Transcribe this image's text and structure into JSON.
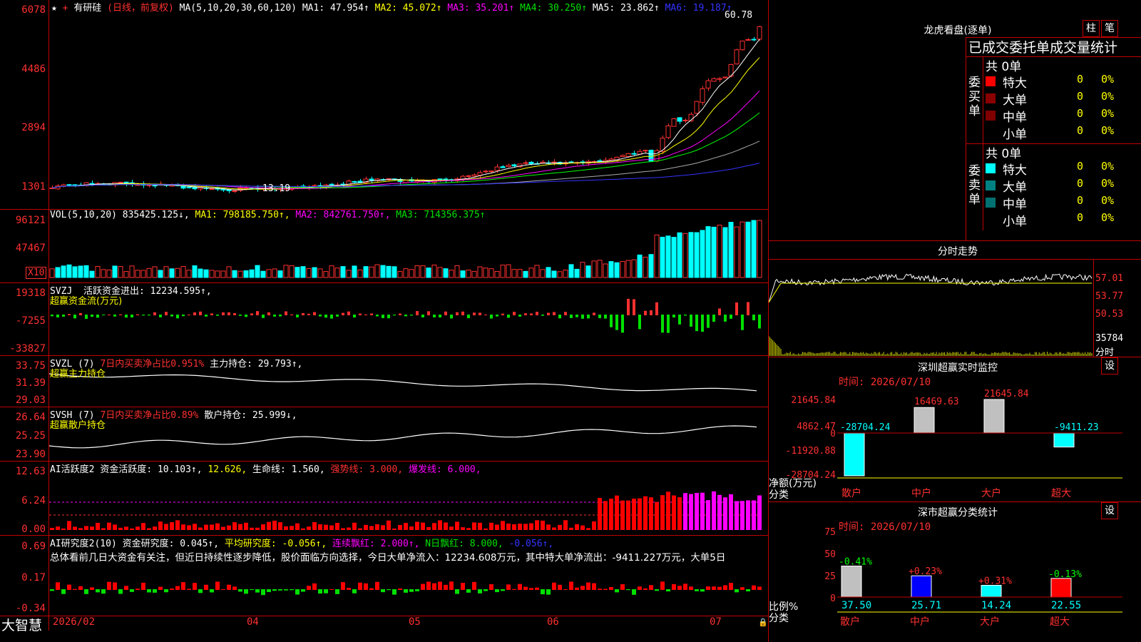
{
  "price": {
    "symbol": "有研硅",
    "period": "(日线，前复权)",
    "ma_params": "MA(5,10,20,30,60,120)",
    "ma1": "MA1: 47.954↑",
    "ma2": "MA2: 45.072↑",
    "ma3": "MA3: 35.201↑",
    "ma4": "MA4: 30.250↑",
    "ma5": "MA5: 23.862↑",
    "ma6": "MA6: 19.187↑",
    "high_marker": "60.78",
    "low_marker": "13.19",
    "ticks": [
      "6078",
      "4486",
      "2894",
      "1301"
    ]
  },
  "vol": {
    "title": "VOL(5,10,20)",
    "value": "835425.125↓,",
    "ma1": "MA1: 798185.750↑,",
    "ma2": "MA2: 842761.750↑,",
    "ma3": "MA3: 714356.375↑",
    "ticks": [
      "96121",
      "47467"
    ],
    "multiplier": "X10"
  },
  "svzj": {
    "title": "SVZJ",
    "desc": "活跃资金进出: 12234.595↑,",
    "sub": "超赢资金流(万元)",
    "ticks": [
      "19318",
      "-7255",
      "-33827"
    ]
  },
  "svzl": {
    "title": "SVZL  (7)",
    "ratio": "7日内买卖净占比0.951%",
    "main": "主力持仓: 29.793↑,",
    "sub": "超赢主力持仓",
    "ticks": [
      "33.75",
      "31.39",
      "29.03"
    ]
  },
  "svsh": {
    "title": "SVSH  (7)",
    "ratio": "7日内买卖净占比0.89%",
    "retail": "散户持仓: 25.999↓,",
    "sub": "超赢散户持仓",
    "ticks": [
      "26.64",
      "25.25",
      "23.90"
    ]
  },
  "ai1": {
    "title": "AI活跃度2",
    "a": "资金活跃度: 10.103↑,",
    "b": "12.626,",
    "c": "生命线: 1.560,",
    "d": "强势线: 3.000,",
    "e": "爆发线: 6.000,",
    "ticks": [
      "12.63",
      "6.24",
      "0.00"
    ]
  },
  "ai2": {
    "title": "AI研究度2(10)",
    "a": "资金研究度: 0.045↑,",
    "b": "平均研究度: -0.056↑,",
    "c": "连续飘红: 2.000↑,",
    "d": "N日飘红: 8.000,",
    "e": "-0.056↑,",
    "summary": "总体看前几日大资金有关注，但近日持续性逐步降低，股价面临方向选择，今日大单净流入：12234.608万元，其中特大单净流出：-9411.227万元，大单5日",
    "ticks": [
      "0.69",
      "0.17",
      "-0.34"
    ]
  },
  "bottom": {
    "brand": "大智慧",
    "dates": [
      "2026/02",
      "04",
      "05",
      "06",
      "07"
    ]
  },
  "right": {
    "lhb_title": "龙虎看盘(逐单)",
    "btn1": "柱",
    "btn2": "笔",
    "order_header": "已成交委托单成交量统计",
    "buy_label": "委买单",
    "sell_label": "委卖单",
    "buy_total": "共 0单",
    "sell_total": "共 0单",
    "rows": [
      {
        "name": "特大",
        "count": "0",
        "pct": "0%"
      },
      {
        "name": "大单",
        "count": "0",
        "pct": "0%"
      },
      {
        "name": "中单",
        "count": "0",
        "pct": "0%"
      },
      {
        "name": "小单",
        "count": "0",
        "pct": "0%"
      }
    ],
    "buy_colors": [
      "#ff0000",
      "#8b0000",
      "#800000",
      "#000000"
    ],
    "sell_colors": [
      "#00ffff",
      "#008080",
      "#007070",
      "#000000"
    ],
    "intraday_title": "分时走势",
    "intraday_ticks": [
      "57.01",
      "53.77",
      "50.53",
      "35784"
    ],
    "intraday_unit": "分时",
    "sz_title": "深圳超赢实时监控",
    "sz_btn": "设",
    "sz_time": "时间: 2026/07/10",
    "sz_ticks": [
      "21645.84",
      "4862.47",
      "0",
      "-11920.88",
      "-28704.24"
    ],
    "sz_unit": "净额(万元)",
    "sz_cat": "分类",
    "sz_bars": [
      {
        "label": "散户",
        "value": -28704.24,
        "text": "-28704.24"
      },
      {
        "label": "中户",
        "value": 16469.63,
        "text": "16469.63"
      },
      {
        "label": "大户",
        "value": 21645.84,
        "text": "21645.84"
      },
      {
        "label": "超大",
        "value": -9411.23,
        "text": "-9411.23"
      }
    ],
    "st_title": "深市超赢分类统计",
    "st_btn": "设",
    "st_time": "时间: 2026/07/10",
    "st_ticks": [
      "75",
      "50",
      "25",
      "0"
    ],
    "st_unit": "比例%",
    "st_cat": "分类",
    "st_bars": [
      {
        "label": "散户",
        "value": 37.5,
        "text": "37.50",
        "change": "-0.41%"
      },
      {
        "label": "中户",
        "value": 25.71,
        "text": "25.71",
        "change": "+0.23%"
      },
      {
        "label": "大户",
        "value": 14.24,
        "text": "14.24",
        "change": "+0.31%"
      },
      {
        "label": "超大",
        "value": 22.55,
        "text": "22.55",
        "change": "-0.13%"
      }
    ]
  }
}
